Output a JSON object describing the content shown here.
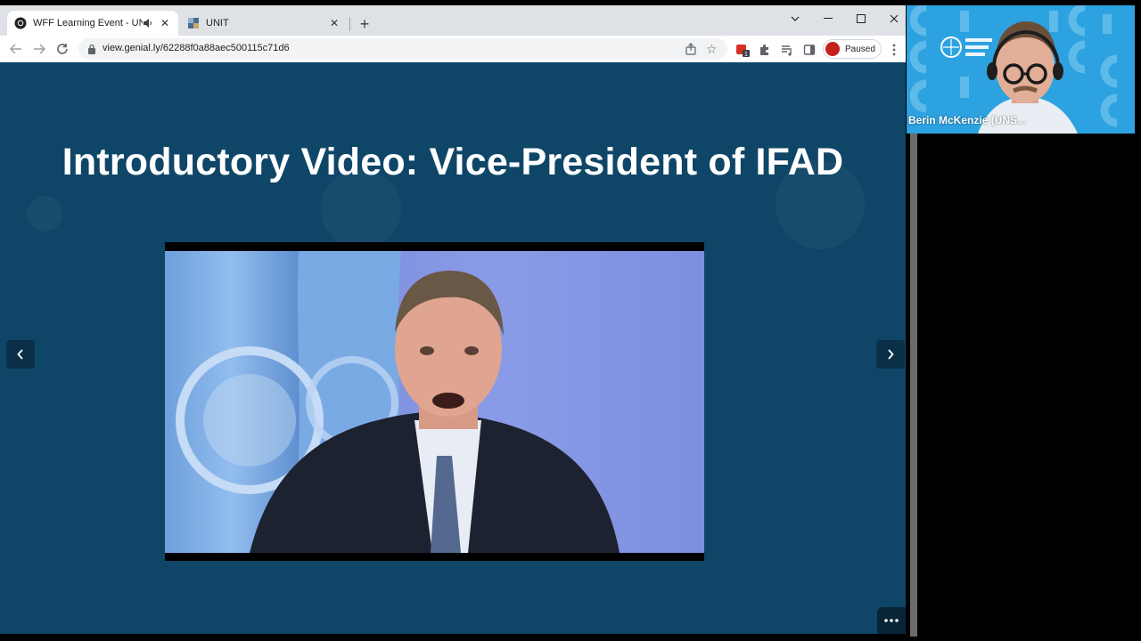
{
  "browser": {
    "tabs": [
      {
        "title": "WFF Learning Event - UN Inn",
        "active": true
      },
      {
        "title": "UNIT",
        "active": false
      }
    ],
    "url": "view.genial.ly/62288f0a88aec500115c71d6",
    "profile_status": "Paused",
    "extension_badge": "1"
  },
  "slide": {
    "title": "Introductory Video: Vice-President of IFAD"
  },
  "call": {
    "participant_name": "Berin McKenzie (UNS..."
  },
  "colors": {
    "slide_bg": "#0f4668",
    "tab_strip": "#dee1e6",
    "paused_red": "#c5221f",
    "call_bg": "#2da2e0"
  },
  "icons": [
    "chrome-icon",
    "speaker-icon",
    "close-icon",
    "plus-icon",
    "chevron-down-icon",
    "minimize-icon",
    "maximize-icon",
    "back-icon",
    "forward-icon",
    "reload-icon",
    "lock-icon",
    "share-icon",
    "star-icon",
    "extension-icon",
    "puzzle-icon",
    "media-queue-icon",
    "sidebar-icon",
    "kebab-icon",
    "chevron-left-icon",
    "chevron-right-icon",
    "more-dots-icon"
  ]
}
